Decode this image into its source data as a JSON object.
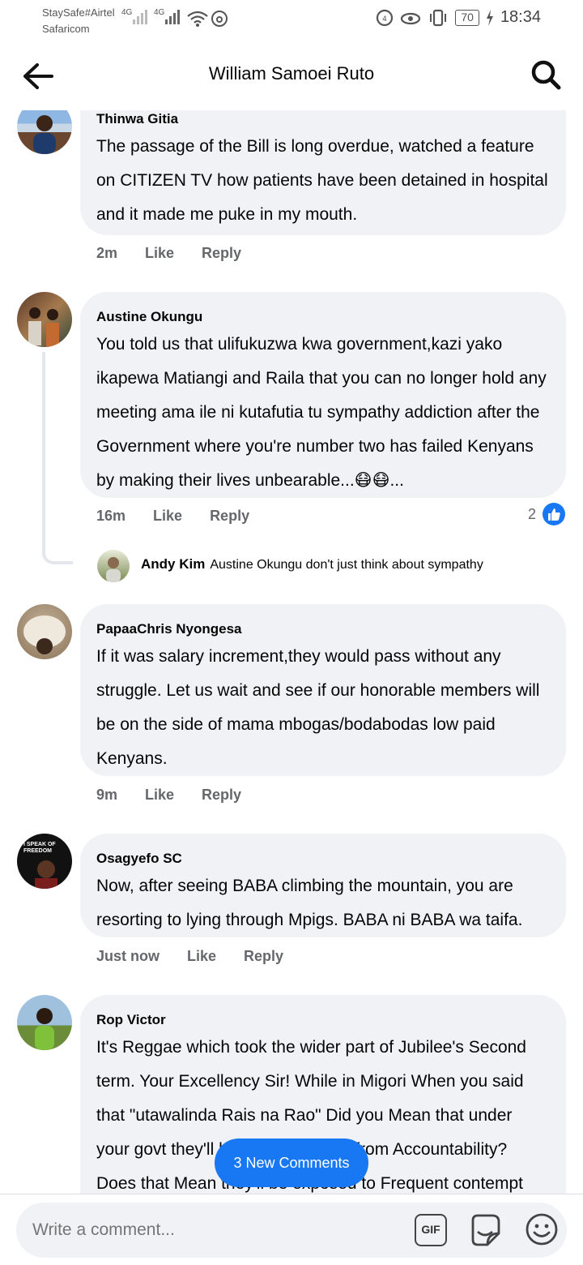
{
  "status": {
    "carrier1": "StaySafe#Airtel",
    "carrier2": "Safaricom",
    "net1": "4G",
    "net2": "4G",
    "battery": "70",
    "time": "18:34"
  },
  "header": {
    "title": "William Samoei Ruto"
  },
  "comments": [
    {
      "author": "Thinwa Gitia",
      "text": "The passage of the Bill is long overdue, watched a feature on CITIZEN TV how patients have been detained in hospital and it made me puke in my mouth.",
      "time": "2m",
      "like": "Like",
      "reply": "Reply"
    },
    {
      "author": "Austine Okungu",
      "text": "You told us that ulifukuzwa kwa government,kazi yako ikapewa Matiangi and Raila that you can no longer hold any meeting ama ile ni kutafutia tu sympathy addiction after the Government where you're number two has failed Kenyans by making their lives unbearable...😷😷...",
      "time": "16m",
      "like": "Like",
      "reply": "Reply",
      "reactions": "2",
      "reply_author": "Andy Kim",
      "reply_text": "Austine Okungu don't just think about sympathy"
    },
    {
      "author": "PapaaChris Nyongesa",
      "text": "If it was salary increment,they would pass without any struggle. Let us wait and see if our honorable members will be on the side of mama mbogas/bodabodas low paid Kenyans.",
      "time": "9m",
      "like": "Like",
      "reply": "Reply"
    },
    {
      "author": "Osagyefo SC",
      "avatar_text": "I SPEAK OF FREEDOM",
      "text": "Now, after seeing BABA climbing the mountain, you are resorting to lying through Mpigs. BABA ni BABA wa taifa.",
      "time": "Just now",
      "like": "Like",
      "reply": "Reply"
    },
    {
      "author": "Rop Victor",
      "text": "It's Reggae which took the wider part of Jubilee's Second term. Your Excellency Sir! While in Migori When you said that \"utawalinda Rais na Rao\" Did you Mean that under your govt they'll be shielded away from Accountability? Does that Mean they'll be exposed to Frequent contempt"
    }
  ],
  "new_comments": "3 New Comments",
  "composer": {
    "placeholder": "Write a comment...",
    "gif": "GIF"
  },
  "colors": {
    "accent": "#1877f2",
    "bubble": "#f0f2f5",
    "meta": "#65676b"
  }
}
